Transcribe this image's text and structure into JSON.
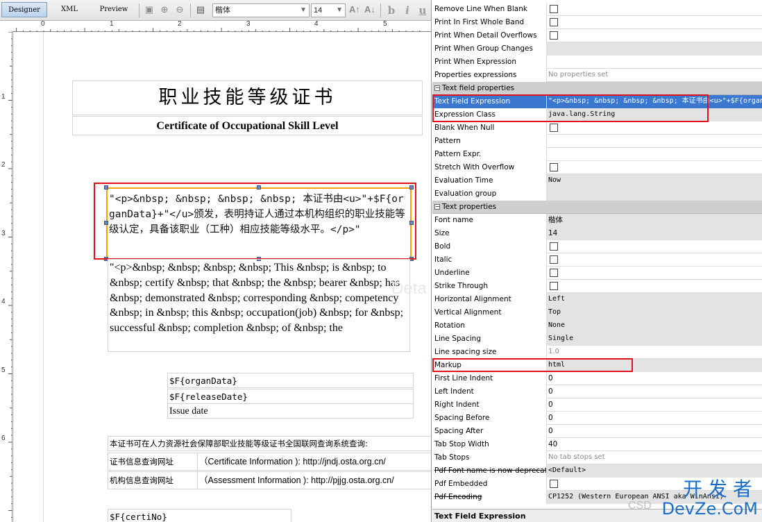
{
  "tabs": {
    "designer": "Designer",
    "xml": "XML",
    "preview": "Preview"
  },
  "toolbar": {
    "font_name": "楷体",
    "font_size": "14",
    "icons": [
      "page-icon",
      "zoom-in-icon",
      "zoom-out-icon",
      "report-icon",
      "font-grow-icon",
      "font-shrink-icon",
      "bold-icon",
      "italic-icon",
      "underline-icon"
    ],
    "bold_glyph": "b",
    "italic_glyph": "i",
    "underline_glyph": "u"
  },
  "ruler": {
    "top": [
      "0",
      "1",
      "2",
      "3",
      "4",
      "5"
    ],
    "left": [
      "1",
      "2",
      "3",
      "4",
      "5",
      "6"
    ]
  },
  "report": {
    "title_cn": "职业技能等级证书",
    "title_en": "Certificate of Occupational Skill Level",
    "cn_expression": "\"<p>&nbsp; &nbsp; &nbsp; &nbsp; 本证书由<u>\"+$F{organData}+\"</u>颁发，表明持证人通过本机构组织的职业技能等级认定，具备该职业（工种）相应技能等级水平。</p>\"",
    "en_expression": "\"<p>&nbsp; &nbsp; &nbsp; &nbsp; This &nbsp; is &nbsp; to &nbsp; certify &nbsp; that &nbsp; the &nbsp; bearer &nbsp; has &nbsp; demonstrated &nbsp; corresponding &nbsp; competency &nbsp; in &nbsp; this &nbsp; occupation(job) &nbsp; for &nbsp; successful &nbsp; completion &nbsp; of &nbsp; the",
    "band_watermark": "Deta",
    "organ_field": "$F{organData}",
    "release_field": "$F{releaseDate}",
    "issue_date": "Issue date",
    "query_line": "本证书可在人力资源社会保障部职业技能等级证书全国联网查询系统查询:",
    "cert_query_label": "证书信息查询网址",
    "cert_query_value": "（Certificate Information ): http://jndj.osta.org.cn/",
    "org_query_label": "机构信息查询网址",
    "org_query_value": "（Assessment Information ): http://pjjg.osta.org.cn/",
    "bottom_field": "$F{certiNo}"
  },
  "properties": {
    "rows_top": [
      {
        "name": "Remove Line When Blank",
        "type": "checkbox"
      },
      {
        "name": "Print In First Whole Band",
        "type": "checkbox"
      },
      {
        "name": "Print When Detail Overflows",
        "type": "checkbox"
      },
      {
        "name": "Print When Group Changes",
        "type": "gray",
        "value": ""
      },
      {
        "name": "Print When Expression",
        "type": "plain",
        "value": ""
      },
      {
        "name": "Properties expressions",
        "type": "muted",
        "value": "No properties set"
      }
    ],
    "cat_text_field": "Text field properties",
    "rows_textfield": [
      {
        "name": "Text Field Expression",
        "type": "selected",
        "value": "\"<p>&nbsp; &nbsp; &nbsp; &nbsp; 本证书由<u>\"+$F{organData}+\"</u>"
      },
      {
        "name": "Expression Class",
        "type": "gray-mono",
        "value": "java.lang.String"
      },
      {
        "name": "Blank When Null",
        "type": "checkbox"
      },
      {
        "name": "Pattern",
        "type": "plain",
        "value": ""
      },
      {
        "name": "Pattern Expr.",
        "type": "plain",
        "value": ""
      },
      {
        "name": "Stretch With Overflow",
        "type": "checkbox"
      },
      {
        "name": "Evaluation Time",
        "type": "gray-mono",
        "value": "Now"
      },
      {
        "name": "Evaluation group",
        "type": "gray",
        "value": ""
      }
    ],
    "cat_text": "Text properties",
    "rows_text": [
      {
        "name": "Font name",
        "type": "gray-plain",
        "value": "楷体"
      },
      {
        "name": "Size",
        "type": "gray-plain",
        "value": "14"
      },
      {
        "name": "Bold",
        "type": "checkbox"
      },
      {
        "name": "Italic",
        "type": "checkbox"
      },
      {
        "name": "Underline",
        "type": "checkbox"
      },
      {
        "name": "Strike Through",
        "type": "checkbox"
      },
      {
        "name": "Horizontal Alignment",
        "type": "gray-mono",
        "value": "Left"
      },
      {
        "name": "Vertical Alignment",
        "type": "gray-mono",
        "value": "Top"
      },
      {
        "name": "Rotation",
        "type": "gray-mono",
        "value": "None"
      },
      {
        "name": "Line Spacing",
        "type": "gray-mono",
        "value": "Single"
      },
      {
        "name": "Line spacing size",
        "type": "muted",
        "value": "1.0"
      },
      {
        "name": "Markup",
        "type": "gray-mono",
        "value": "html"
      },
      {
        "name": "First Line Indent",
        "type": "plain",
        "value": "0"
      },
      {
        "name": "Left Indent",
        "type": "plain",
        "value": "0"
      },
      {
        "name": "Right Indent",
        "type": "plain",
        "value": "0"
      },
      {
        "name": "Spacing Before",
        "type": "plain",
        "value": "0"
      },
      {
        "name": "Spacing After",
        "type": "plain",
        "value": "0"
      },
      {
        "name": "Tab Stop Width",
        "type": "plain",
        "value": "40"
      },
      {
        "name": "Tab Stops",
        "type": "muted",
        "value": "No tab stops set"
      },
      {
        "name": "Pdf Font name is now deprecated",
        "type": "gray-mono",
        "value": "<Default>",
        "strike": true
      },
      {
        "name": "Pdf Embedded",
        "type": "checkbox"
      },
      {
        "name": "Pdf Encoding",
        "type": "gray-mono",
        "value": "CP1252 (Western European ANSI aka WinAnsi)",
        "strike": true
      }
    ],
    "footer": "Text Field Expression"
  },
  "watermark": {
    "cn": "开发者",
    "en": "DevZe.CoM",
    "csd": "CSD"
  },
  "colors": {
    "selection": "#3a78d0",
    "highlight_red": "#e0121e",
    "field_border": "#f0a400",
    "designer_tab": "#bcd3ee"
  }
}
